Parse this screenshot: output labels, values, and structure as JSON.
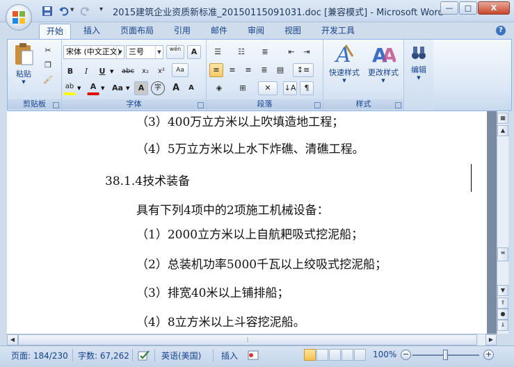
{
  "window": {
    "title": "2015建筑企业资质新标准_20150115091031.doc [兼容模式] - Microsoft Word",
    "minimize": "—",
    "maximize": "□",
    "close": "X"
  },
  "quick_access": [
    {
      "icon": "save-icon"
    },
    {
      "icon": "undo-icon"
    },
    {
      "icon": "redo-icon"
    }
  ],
  "ribbon_tabs": [
    "开始",
    "插入",
    "页面布局",
    "引用",
    "邮件",
    "审阅",
    "视图",
    "开发工具"
  ],
  "ribbon": {
    "clipboard": {
      "label": "剪贴板",
      "paste": "粘贴"
    },
    "font": {
      "label": "字体",
      "font_name": "宋体 (中文正文)",
      "font_size": "三号",
      "wen": "wén",
      "A_box": "A",
      "bold": "B",
      "italic": "I",
      "underline": "U",
      "strike": "abc",
      "sub": "x₂",
      "sup": "x²",
      "clear": "Aa",
      "highlight": "ab",
      "font_color": "A",
      "change_case": "Aa",
      "char_shade": "A",
      "enclose": "字",
      "grow": "A",
      "shrink": "A"
    },
    "paragraph": {
      "label": "段落"
    },
    "styles": {
      "label": "样式",
      "quick": "快速样式",
      "change": "更改样式"
    },
    "editing": {
      "label": "编辑"
    }
  },
  "document": {
    "lines": [
      "（3）400万立方米以上吹填造地工程；",
      "（4）5万立方米以上水下炸礁、清礁工程。",
      "38.1.4技术装备",
      "具有下列4项中的2项施工机械设备：",
      "（1）2000立方米以上自航耙吸式挖泥船；",
      "（2）总装机功率5000千瓦以上绞吸式挖泥船；",
      "（3）排宽40米以上铺排船；",
      "（4）8立方米以上斗容挖泥船。"
    ]
  },
  "statusbar": {
    "page": "页面: 184/230",
    "words": "字数: 67,262",
    "language": "英语(美国)",
    "mode": "插入",
    "zoom": "100%",
    "zoom_out": "−",
    "zoom_in": "+"
  },
  "colors": {
    "ribbon_text": "#15428b",
    "highlight": "#ffff00",
    "font_color_bar": "#e00000"
  }
}
